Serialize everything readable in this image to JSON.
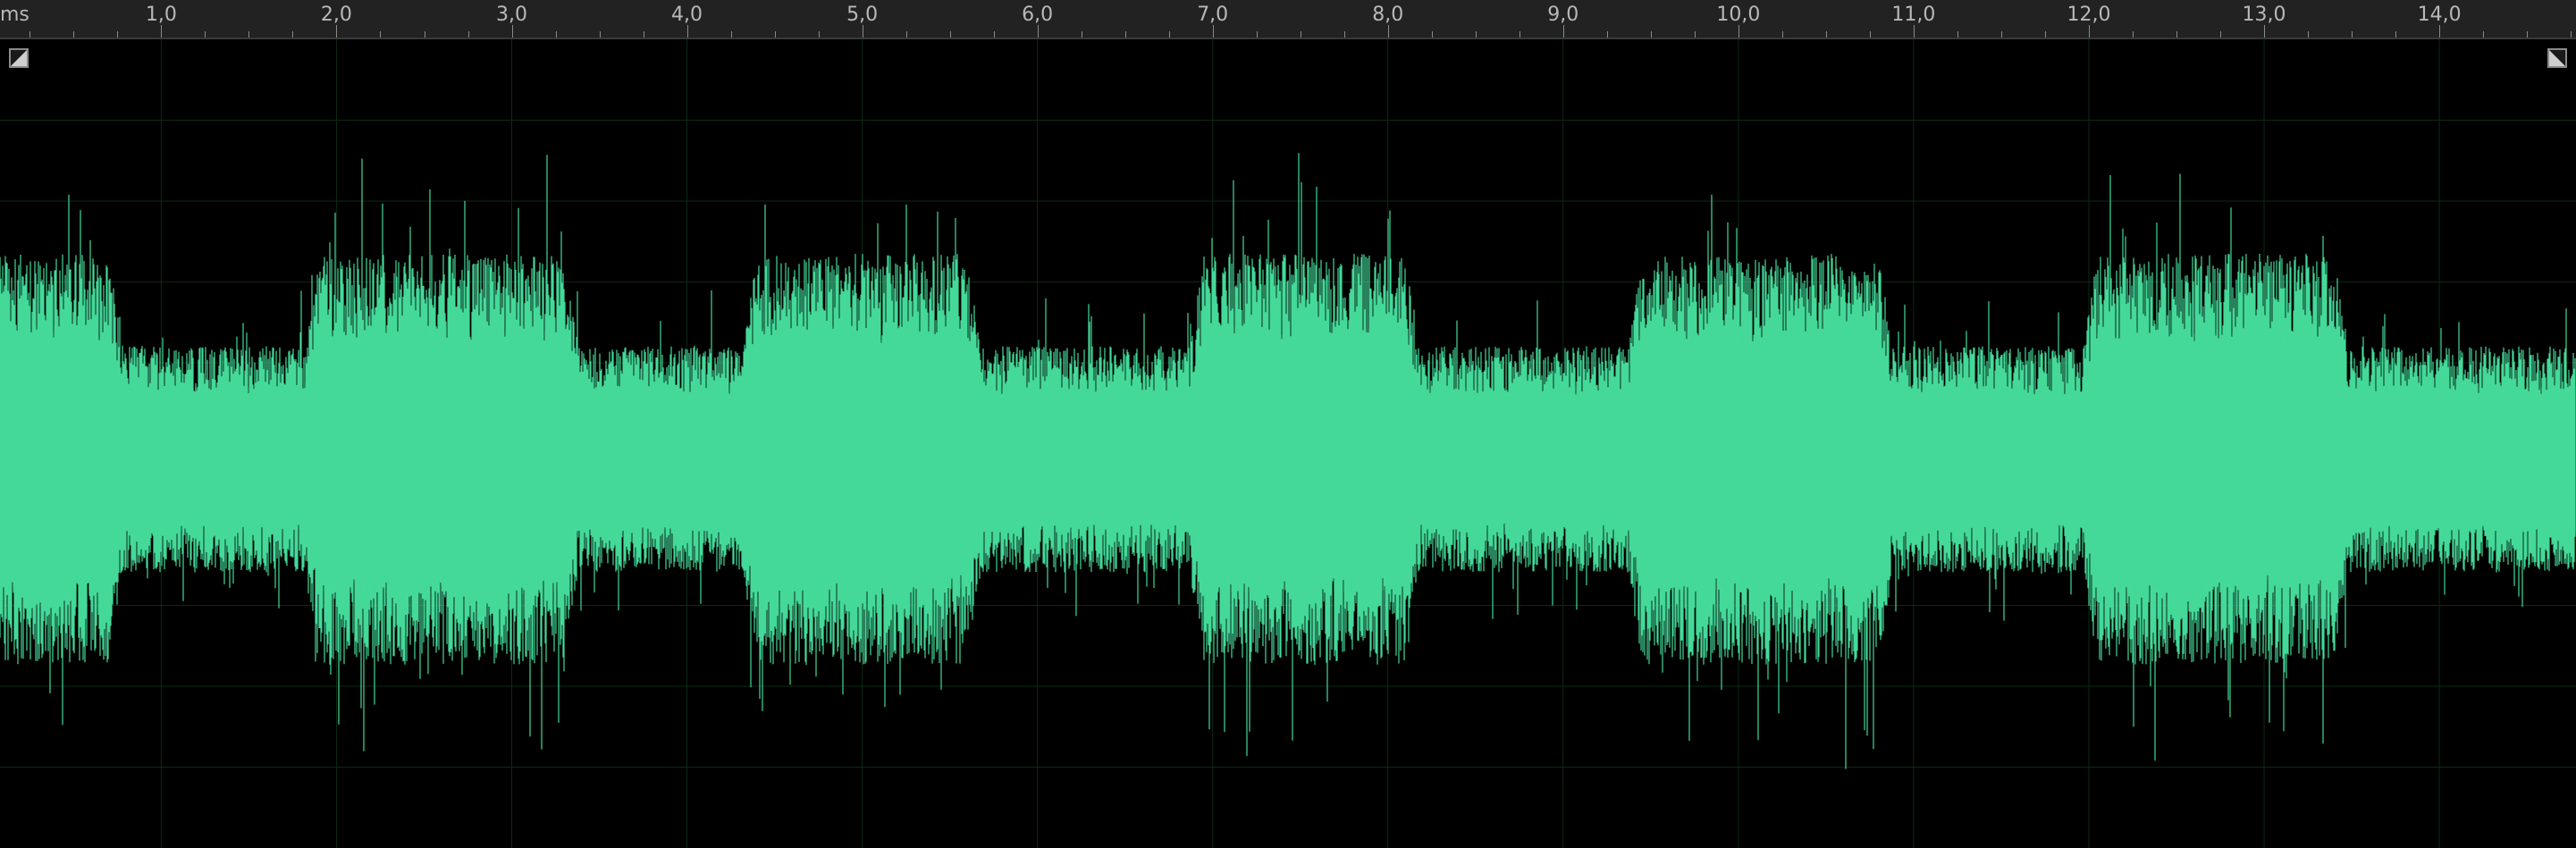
{
  "window": {
    "title": ""
  },
  "ruler": {
    "unit": "ms",
    "labels": [
      "1,0",
      "2,0",
      "3,0",
      "4,0",
      "5,0",
      "6,0",
      "7,0",
      "8,0",
      "9,0",
      "10,0",
      "11,0",
      "12,0",
      "13,0",
      "14,0"
    ],
    "values": [
      1,
      2,
      3,
      4,
      5,
      6,
      7,
      8,
      9,
      10,
      11,
      12,
      13,
      14
    ],
    "visible_range_ms": [
      0.08,
      14.78
    ]
  },
  "waveform": {
    "color": "#44d999",
    "background": "#000000",
    "gridColor": "#0c2a14",
    "icons": {
      "fade_in": "fade-in-handle-icon",
      "fade_out": "fade-out-handle-icon"
    }
  }
}
